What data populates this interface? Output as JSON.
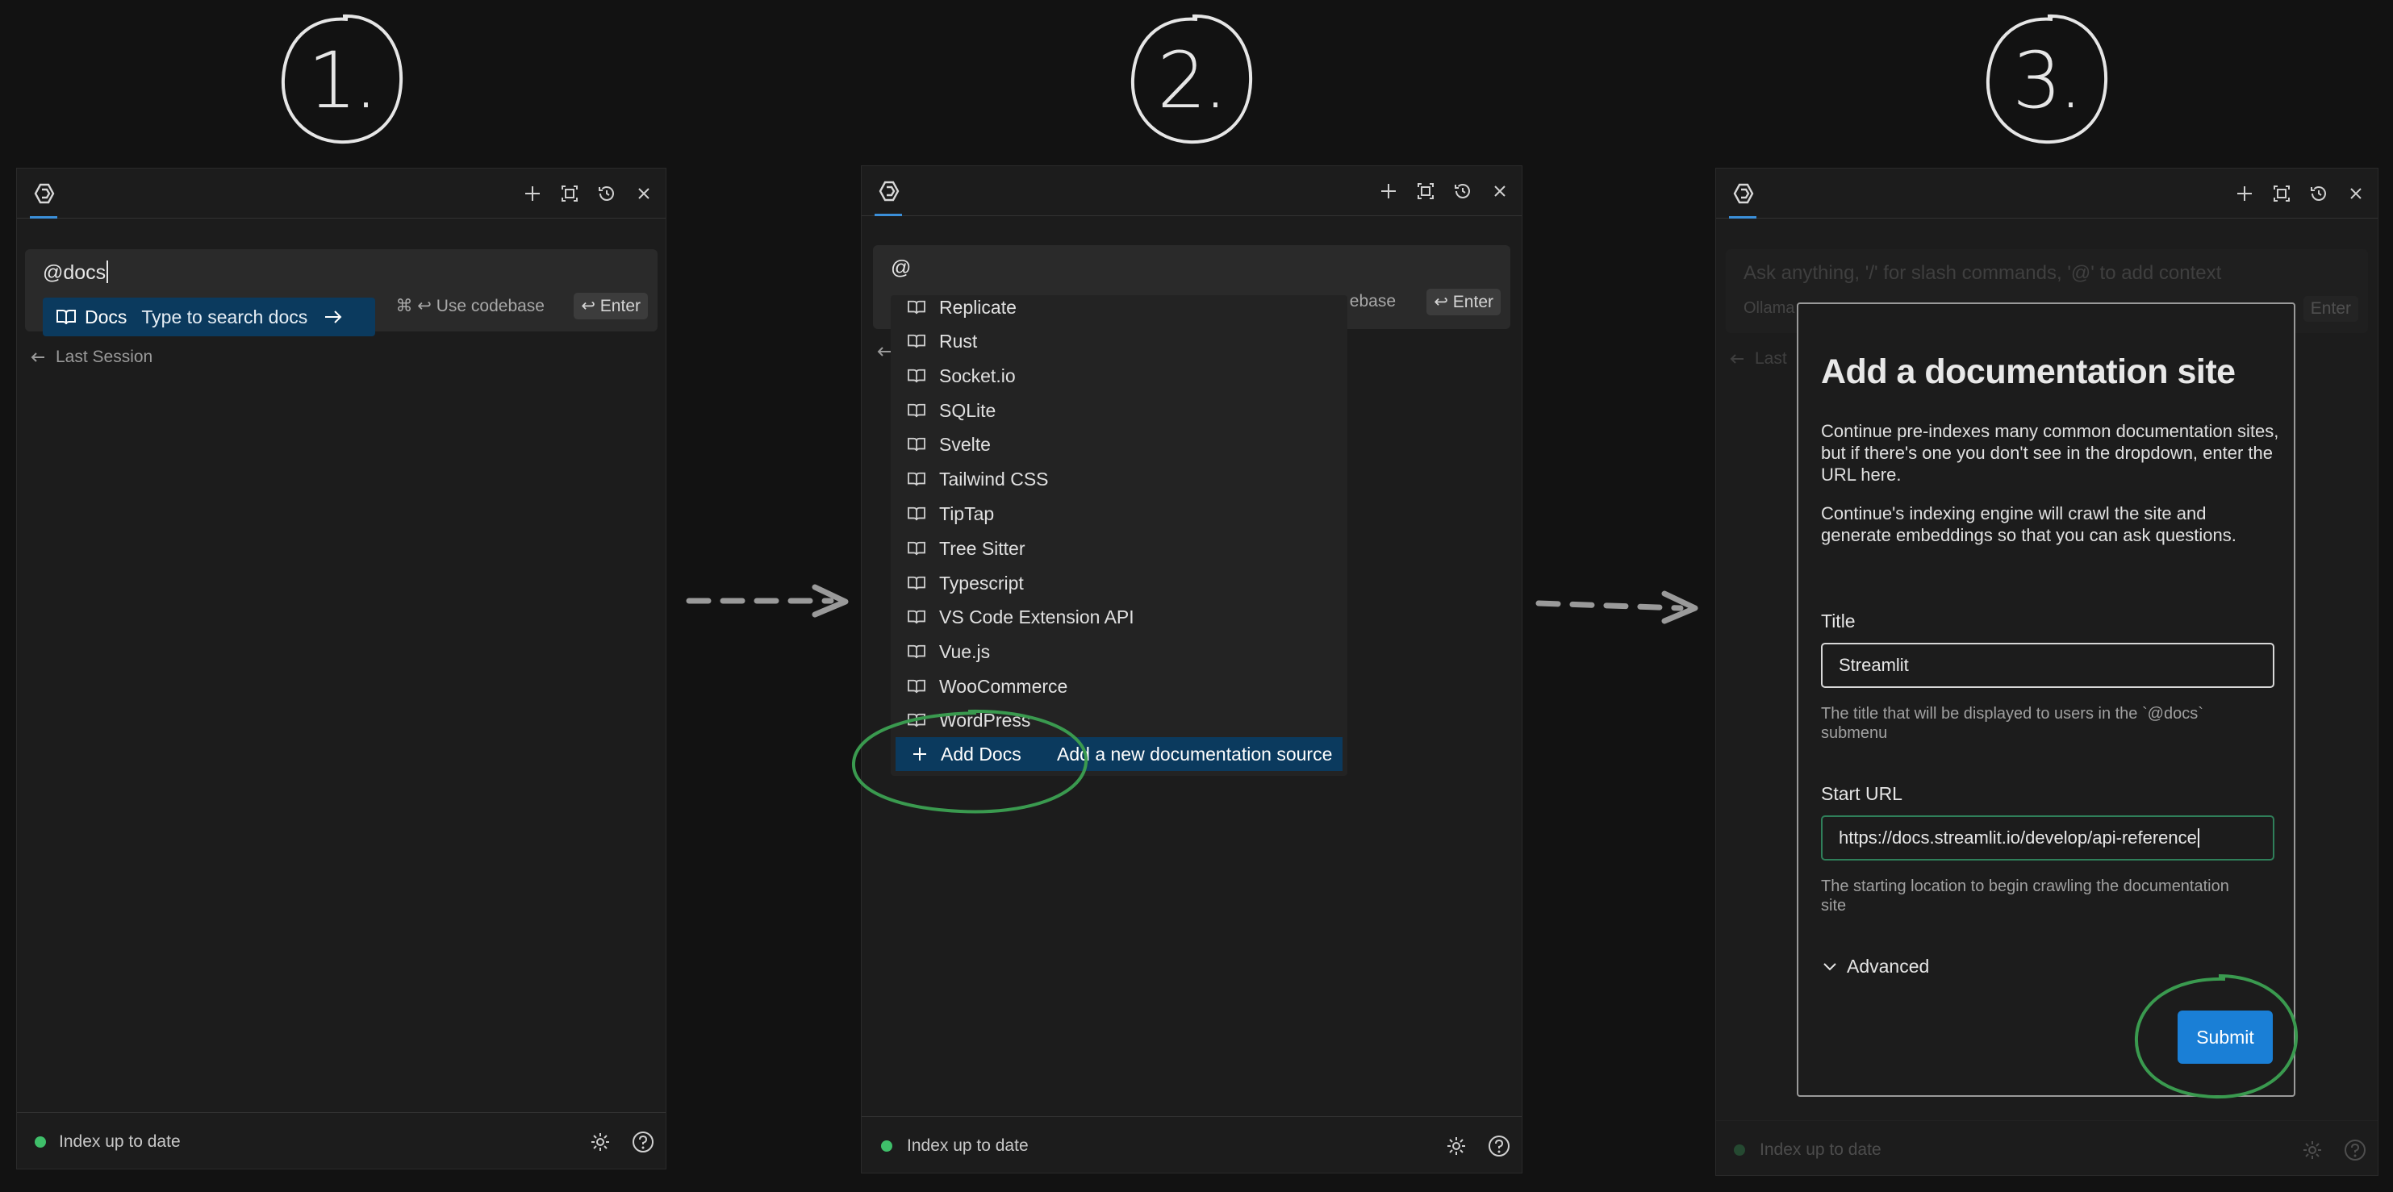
{
  "steps": [
    {
      "label": "1."
    },
    {
      "label": "2."
    },
    {
      "label": "3."
    }
  ],
  "panel1": {
    "input_value": "@docs",
    "suggestion": {
      "title": "Docs",
      "subtitle": "Type to search docs",
      "icon": "book-icon"
    },
    "hint_use_codebase": "⌘ ↩ Use codebase",
    "hint_enter": "↩ Enter",
    "last_session": "Last Session",
    "status": "Index up to date"
  },
  "panel2": {
    "input_value": "@",
    "hint_codebase_partial": "ebase",
    "hint_enter": "↩ Enter",
    "docs_items": [
      "Replicate",
      "Rust",
      "Socket.io",
      "SQLite",
      "Svelte",
      "Tailwind CSS",
      "TipTap",
      "Tree Sitter",
      "Typescript",
      "VS Code Extension API",
      "Vue.js",
      "WooCommerce",
      "WordPress"
    ],
    "add_item": {
      "title": "Add Docs",
      "description": "Add a new documentation source"
    },
    "status": "Index up to date"
  },
  "panel3": {
    "input_placeholder": "Ask anything, '/' for slash commands, '@' to add context",
    "model_partial": "Ollama",
    "hint_enter": "Enter",
    "last_session_partial": "Last",
    "status": "Index up to date",
    "dialog": {
      "title": "Add a documentation site",
      "para1": "Continue pre-indexes many common documentation sites, but if there's one you don't see in the dropdown, enter the URL here.",
      "para2": "Continue's indexing engine will crawl the site and generate embeddings so that you can ask questions.",
      "title_label": "Title",
      "title_value": "Streamlit",
      "title_help": "The title that will be displayed to users in the `@docs` submenu",
      "url_label": "Start URL",
      "url_value": "https://docs.streamlit.io/develop/api-reference",
      "url_help": "The starting location to begin crawling the documentation site",
      "advanced_label": "Advanced",
      "submit_label": "Submit"
    }
  },
  "colors": {
    "background": "#121212",
    "panel": "#1c1c1c",
    "selection": "#0b3a5e",
    "accent_blue": "#1a7fd6",
    "annotation_green": "#3a9a4f",
    "status_green": "#3fbf6a"
  }
}
